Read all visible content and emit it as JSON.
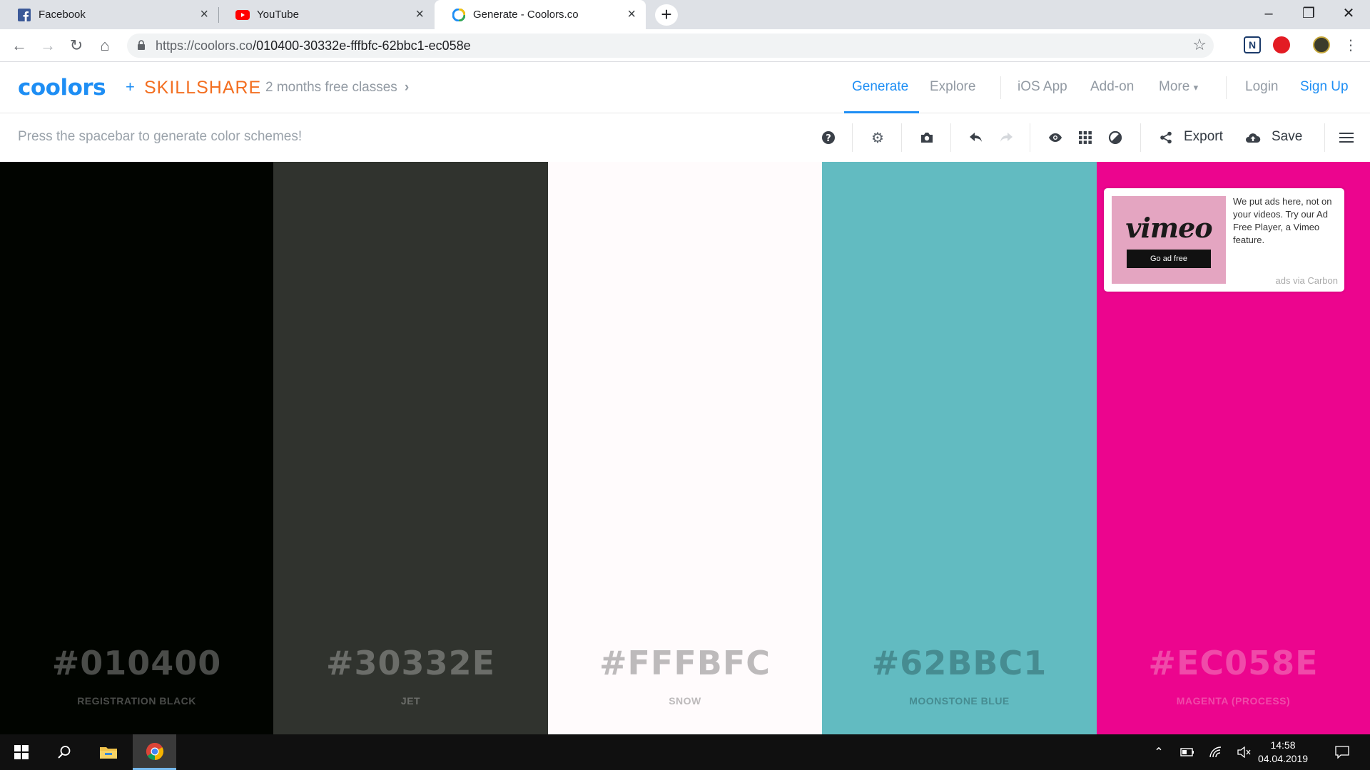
{
  "browser": {
    "tabs": [
      {
        "title": "Facebook",
        "active": false
      },
      {
        "title": "YouTube",
        "active": false
      },
      {
        "title": "Generate - Coolors.co",
        "active": true
      }
    ],
    "url_host": "https://coolors.co",
    "url_path": "/010400-30332e-fffbfc-62bbc1-ec058e"
  },
  "header": {
    "logo": "coolors",
    "plus": "+",
    "partner": "SKILLSHARE",
    "promo": "2 months free classes",
    "nav": {
      "generate": "Generate",
      "explore": "Explore",
      "ios_app": "iOS App",
      "addon": "Add-on",
      "more": "More",
      "login": "Login",
      "signup": "Sign Up"
    }
  },
  "toolbar": {
    "hint": "Press the spacebar to generate color schemes!",
    "export": "Export",
    "save": "Save"
  },
  "palette": [
    {
      "hex": "#010400",
      "name": "REGISTRATION BLACK",
      "bg": "#010400",
      "text_color": "#4a4c49"
    },
    {
      "hex": "#30332E",
      "name": "JET",
      "bg": "#30332e",
      "text_color": "#6b6d69"
    },
    {
      "hex": "#FFFBFC",
      "name": "SNOW",
      "bg": "#fffbfc",
      "text_color": "#bdbabb"
    },
    {
      "hex": "#62BBC1",
      "name": "MOONSTONE BLUE",
      "bg": "#62bbc1",
      "text_color": "#468c91"
    },
    {
      "hex": "#EC058E",
      "name": "MAGENTA (PROCESS)",
      "bg": "#ec058e",
      "text_color": "#f04aa9"
    }
  ],
  "ad": {
    "brand": "vimeo",
    "button": "Go ad free",
    "text": "We put ads here, not on your videos. Try our Ad Free Player, a Vimeo feature.",
    "via": "ads via Carbon"
  },
  "taskbar": {
    "time": "14:58",
    "date": "04.04.2019"
  },
  "colors": {
    "accent": "#1e8ef4",
    "skillshare": "#f36f21"
  }
}
